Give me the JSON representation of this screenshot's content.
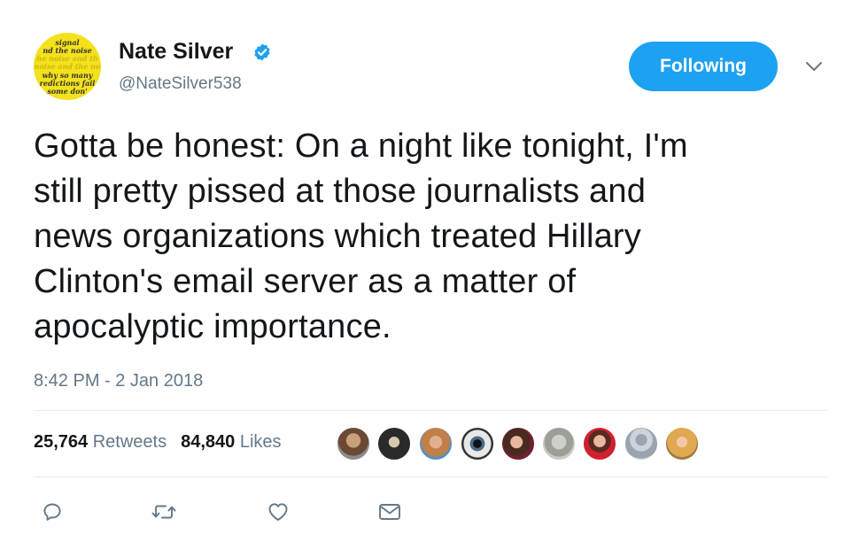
{
  "author": {
    "display_name": "Nate Silver",
    "handle": "@NateSilver538",
    "verified": true,
    "avatar_text_lines": [
      "signal",
      "nd the noise",
      "he noise and th",
      "noise and the no",
      "why so many",
      "redictions fail",
      "some don'"
    ]
  },
  "follow_button": {
    "label": "Following"
  },
  "tweet": {
    "lines": [
      "Gotta be honest: On a night like tonight, I'm",
      "still pretty pissed at those journalists and",
      "news organizations which treated Hillary",
      "Clinton's email server as a matter of",
      "apocalyptic importance."
    ],
    "timestamp": "8:42 PM - 2 Jan 2018"
  },
  "stats": {
    "retweets_count": "25,764",
    "retweets_label": "Retweets",
    "likes_count": "84,840",
    "likes_label": "Likes"
  },
  "colors": {
    "accent": "#1da1f2",
    "text": "#14171a",
    "muted": "#657786",
    "divider": "#e6ecf0",
    "avatar_bg": "#f3e11b"
  },
  "icons": [
    "verified-badge-icon",
    "chevron-down-icon",
    "reply-icon",
    "retweet-icon",
    "like-icon",
    "direct-message-icon"
  ]
}
